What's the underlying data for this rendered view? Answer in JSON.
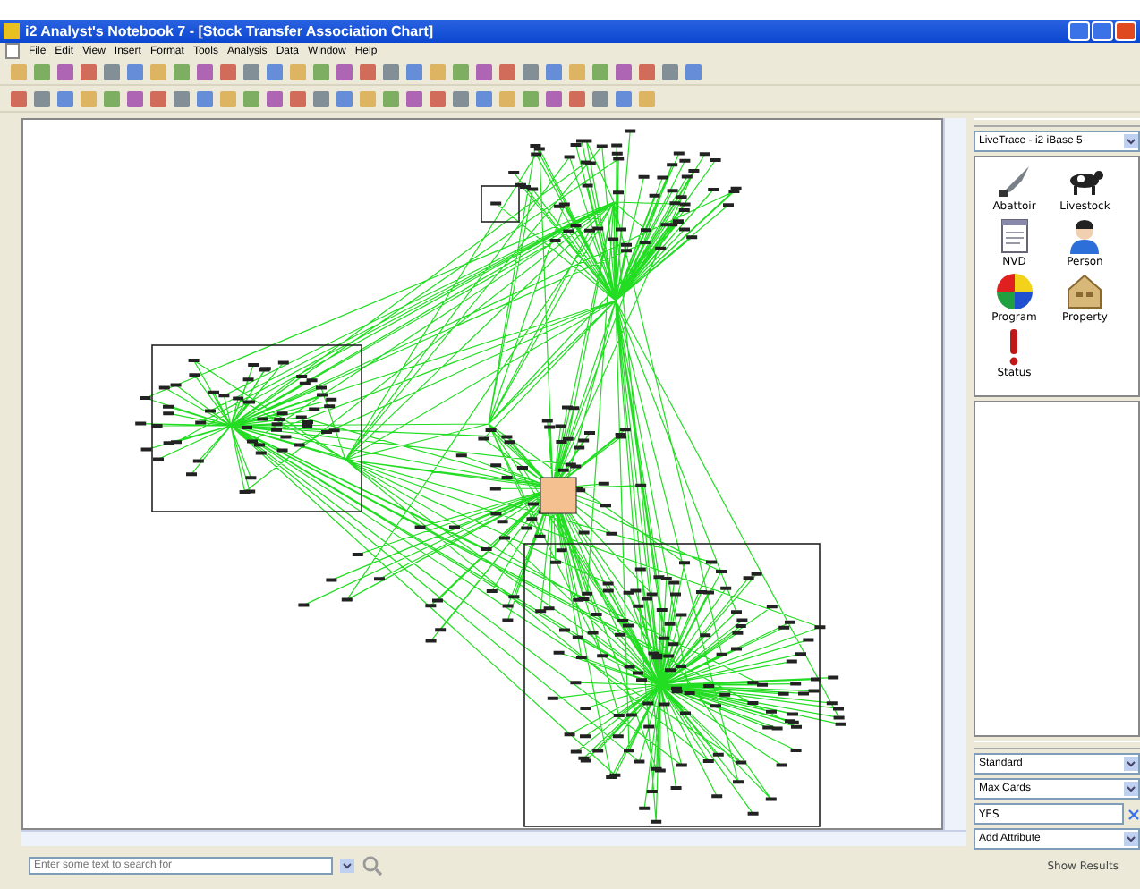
{
  "window": {
    "title": "i2 Analyst's Notebook 7 - [Stock Transfer Association Chart]"
  },
  "menu": [
    {
      "label": "File"
    },
    {
      "label": "Edit"
    },
    {
      "label": "View"
    },
    {
      "label": "Insert"
    },
    {
      "label": "Format"
    },
    {
      "label": "Tools"
    },
    {
      "label": "Analysis"
    },
    {
      "label": "Data"
    },
    {
      "label": "Window"
    },
    {
      "label": "Help"
    }
  ],
  "palette": {
    "source": "LiveTrace - i2 iBase 5",
    "items": [
      {
        "label": "Abattoir",
        "kind": "knife"
      },
      {
        "label": "Livestock",
        "kind": "cow"
      },
      {
        "label": "NVD",
        "kind": "document"
      },
      {
        "label": "Person",
        "kind": "person"
      },
      {
        "label": "Program",
        "kind": "pie"
      },
      {
        "label": "Property",
        "kind": "house"
      },
      {
        "label": "Status",
        "kind": "alert"
      }
    ]
  },
  "attributes": {
    "style": "Standard",
    "attribute": "Max Cards",
    "value": "YES",
    "add": "Add Attribute"
  },
  "search": {
    "placeholder": "Enter some text to search for"
  },
  "show_results": "Show Results"
}
